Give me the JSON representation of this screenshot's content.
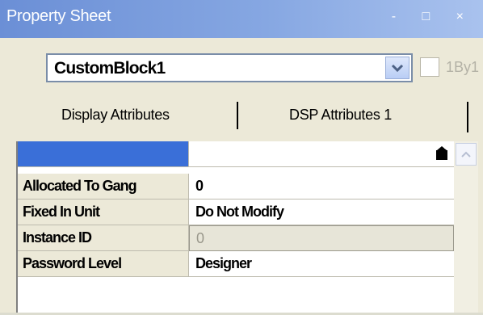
{
  "window": {
    "title": "Property Sheet",
    "title_buttons": "- □ ×"
  },
  "object_selector": {
    "value": "CustomBlock1"
  },
  "checkbox": {
    "label": "1By1",
    "checked": false
  },
  "tabs": [
    {
      "label": "Display Attributes"
    },
    {
      "label": "DSP Attributes 1"
    }
  ],
  "properties": [
    {
      "name": "",
      "value": "",
      "selected": true,
      "has_dropdown": true
    },
    {
      "name": "Allocated To Gang",
      "value": "0"
    },
    {
      "name": "Fixed In Unit",
      "value": "Do Not Modify"
    },
    {
      "name": "Instance ID",
      "value": "0",
      "disabled": true
    },
    {
      "name": "Password Level",
      "value": "Designer"
    }
  ],
  "colors": {
    "titlebar": "#7b9be0",
    "selected_row": "#3a6fd8",
    "panel": "#ece9d8"
  }
}
